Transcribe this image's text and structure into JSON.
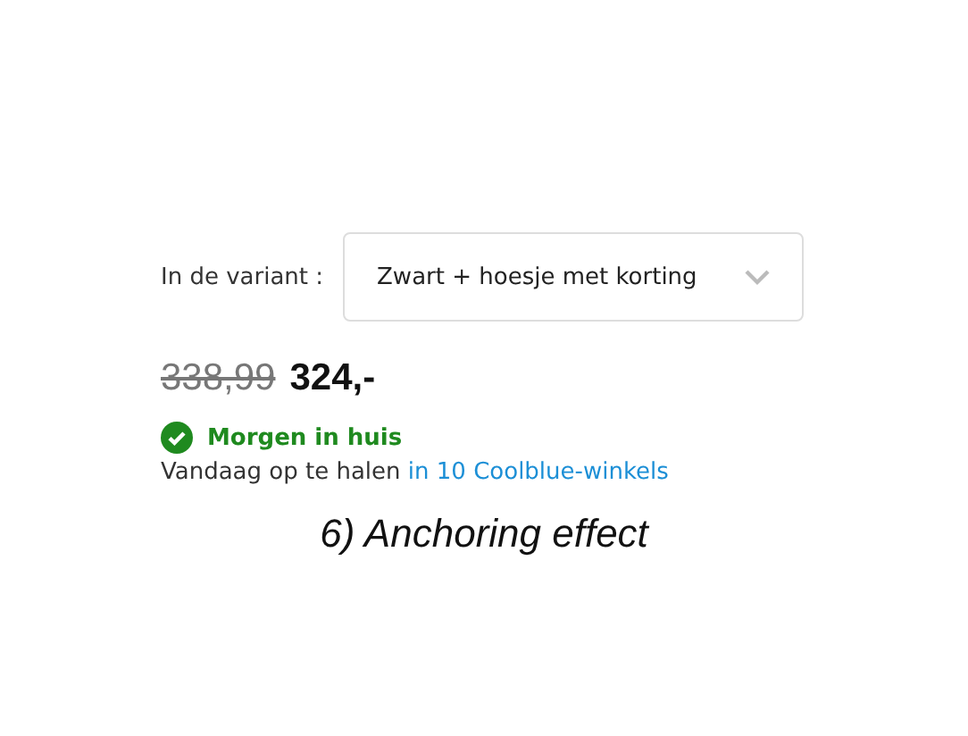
{
  "variant": {
    "label": "In de variant :",
    "value": "Zwart + hoesje met korting"
  },
  "price": {
    "old": "338,99",
    "current": "324,-"
  },
  "delivery": {
    "text": "Morgen in huis"
  },
  "pickup": {
    "text": "Vandaag op te halen",
    "link": "in 10 Coolblue-winkels"
  },
  "caption": "6) Anchoring effect"
}
